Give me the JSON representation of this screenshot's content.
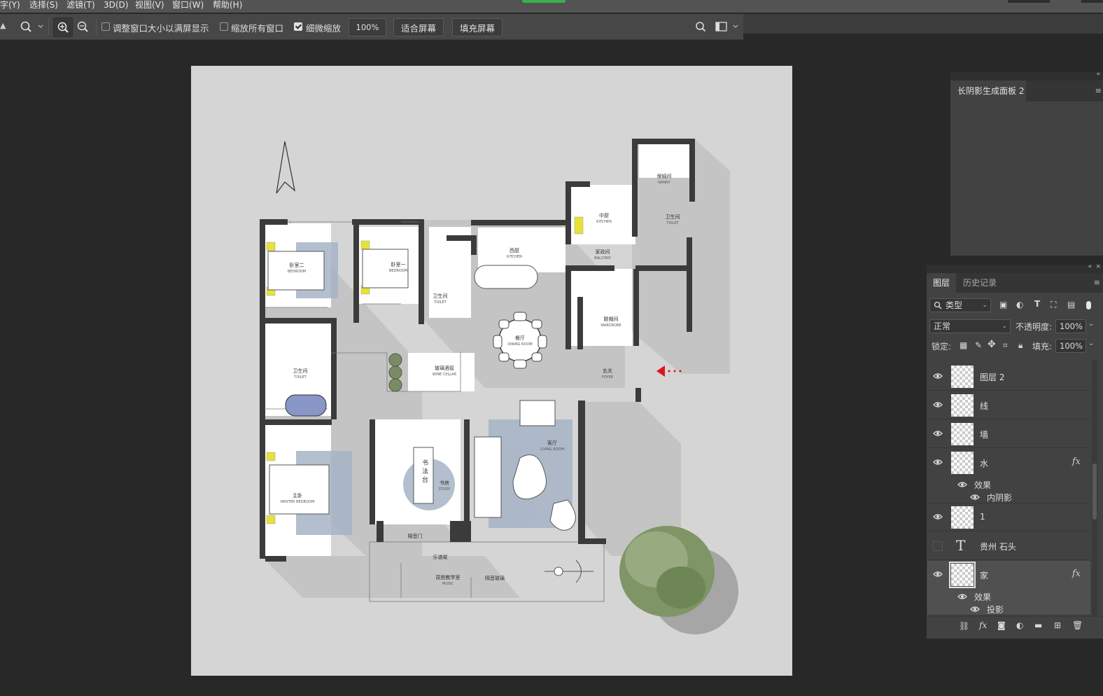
{
  "menu": {
    "items": [
      "字(Y)",
      "选择(S)",
      "滤镜(T)",
      "3D(D)",
      "视图(V)",
      "窗口(W)",
      "帮助(H)"
    ]
  },
  "options": {
    "resize_windows": "调整窗口大小以满屏显示",
    "zoom_all": "缩放所有窗口",
    "scrubby_zoom": "细微缩放",
    "scrubby_checked": true,
    "zoom_value": "100%",
    "fit_screen": "适合屏幕",
    "fill_screen": "填充屏幕"
  },
  "plan": {
    "rooms": {
      "bedroom2": {
        "cn": "卧室二",
        "en": "BEDROOM"
      },
      "bedroom1": {
        "cn": "卧室一",
        "en": "BEDROOM"
      },
      "toilet_mid": {
        "cn": "卫生间",
        "en": "TOILET"
      },
      "western_kitchen": {
        "cn": "西厨",
        "en": "KITCHEN"
      },
      "chinese_kitchen": {
        "cn": "中厨",
        "en": "KITCHEN"
      },
      "nanny": {
        "cn": "保姆间",
        "en": "NANNY"
      },
      "toilet_nanny": {
        "cn": "卫生间",
        "en": "TOILET"
      },
      "balcony": {
        "cn": "家政间",
        "en": "BALCONY"
      },
      "wardrobe": {
        "cn": "鞋帽间",
        "en": "WARDROBE"
      },
      "dining": {
        "cn": "餐厅",
        "en": "DINING ROOM"
      },
      "wine": {
        "cn": "玻璃酒窖",
        "en": "WINE CELLAR"
      },
      "foyer": {
        "cn": "玄关",
        "en": "FOYER"
      },
      "toilet_left": {
        "cn": "卫生间",
        "en": "TOILET"
      },
      "master": {
        "cn": "主卧",
        "en": "MASTER BEDROOM"
      },
      "living": {
        "cn": "客厅",
        "en": "LIVING ROOM"
      },
      "study": {
        "cn": "书房",
        "en": "STUDY"
      },
      "desk": "书法台",
      "door": "隔音门",
      "music_rack": "乐谱架",
      "music": {
        "cn": "琵琶教学室",
        "en": "MUSIC"
      },
      "glass": "隔音玻璃"
    }
  },
  "panel_top": {
    "tab": "长阴影生成面板 2"
  },
  "layers_panel": {
    "tabs": [
      "图层",
      "历史记录"
    ],
    "filter": "类型",
    "blend_mode": "正常",
    "opacity_label": "不透明度:",
    "opacity": "100%",
    "lock_label": "锁定:",
    "fill_label": "填充:",
    "fill": "100%",
    "layers": [
      {
        "name": "图层 2",
        "visible": true,
        "fx": false
      },
      {
        "name": "线",
        "visible": true,
        "fx": false
      },
      {
        "name": "墙",
        "visible": true,
        "fx": false
      },
      {
        "name": "水",
        "visible": true,
        "fx": true,
        "effects_label": "效果",
        "effects": [
          "内阴影"
        ]
      },
      {
        "name": "1",
        "visible": true,
        "fx": false
      },
      {
        "name": "贵州 石头",
        "visible": false,
        "fx": false,
        "type": "text"
      },
      {
        "name": "家",
        "visible": true,
        "fx": true,
        "selected": true,
        "effects_label": "效果",
        "effects": [
          "投影"
        ]
      }
    ]
  },
  "colors": {
    "accent_green": "#3ab04a",
    "canvas_bg": "#d5d5d5",
    "wall": "#3b3b3b",
    "arrow_red": "#e0141e"
  }
}
